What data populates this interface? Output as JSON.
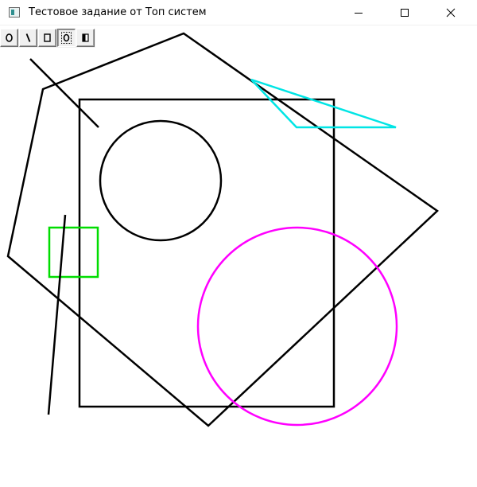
{
  "window": {
    "title": "Тестовое задание от Топ систем",
    "controls": [
      "minimize-icon",
      "maximize-icon",
      "close-icon"
    ]
  },
  "toolbar": {
    "tools": [
      {
        "name": "ellipse-tool",
        "icon": "ellipse-icon",
        "pressed": false
      },
      {
        "name": "line-tool",
        "icon": "line-icon",
        "pressed": false
      },
      {
        "name": "rectangle-tool",
        "icon": "rectangle-icon",
        "pressed": false
      },
      {
        "name": "ellipse-outline-tool",
        "icon": "ellipse-focused-icon",
        "pressed": true
      },
      {
        "name": "fill-tool",
        "icon": "half-fill-icon",
        "pressed": false
      }
    ]
  },
  "shapes": {
    "colors": {
      "black": "#000000",
      "cyan": "#00e5e5",
      "green": "#00dd00",
      "magenta": "#ff00ff"
    }
  }
}
